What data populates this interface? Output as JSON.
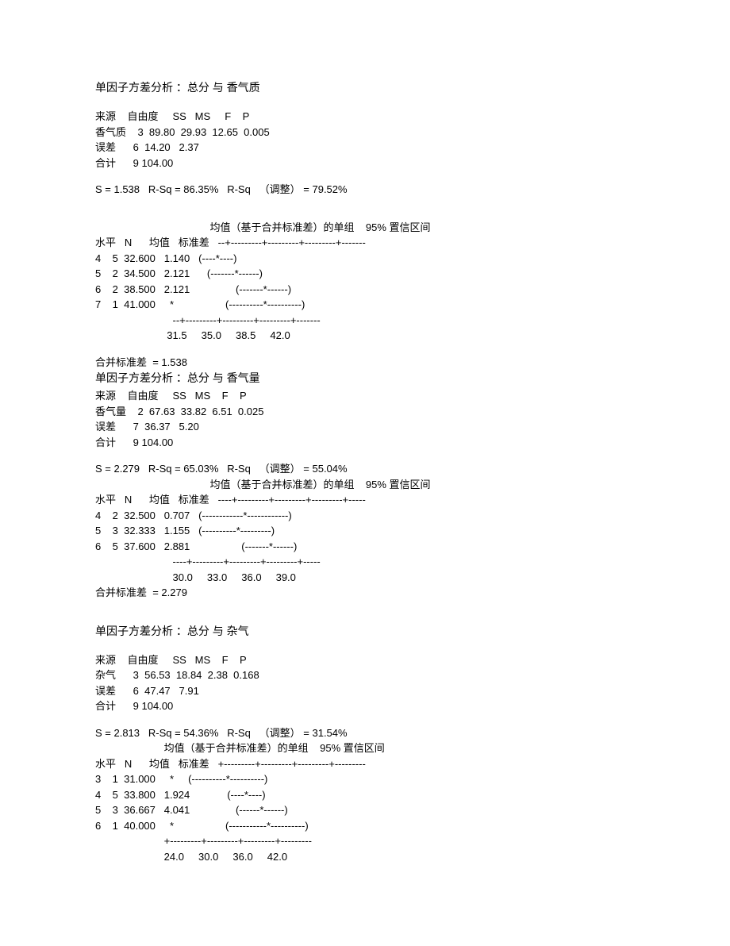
{
  "sections": [
    {
      "title": "单因子方差分析 ：总分  与 香气质",
      "anova_header": "来源    自由度     SS   MS     F    P",
      "anova_rows": [
        "香气质    3  89.80  29.93  12.65  0.005",
        "误差      6  14.20   2.37",
        "合计      9 104.00"
      ],
      "summary": "S = 1.538   R-Sq = 86.35%   R-Sq   （调整） = 79.52%",
      "ci_title": "                                        均值（基于合并标准差）的单组    95% 置信区间",
      "level_header": "水平   N      均值   标准差   --+---------+---------+---------+-------",
      "level_rows": [
        "4    5  32.600   1.140   (----*----)",
        "5    2  34.500   2.121      (-------*------)",
        "6    2  38.500   2.121                (-------*------)",
        "7    1  41.000     *                  (----------*----------)"
      ],
      "axis_ruler": "                           --+---------+---------+---------+-------",
      "axis_labels": "                         31.5     35.0     38.5     42.0",
      "pooled_sd": "合并标准差  = 1.538"
    },
    {
      "title": "单因子方差分析 ：总分  与 香气量",
      "anova_header": "来源    自由度     SS   MS    F    P",
      "anova_rows": [
        "香气量    2  67.63  33.82  6.51  0.025",
        "误差      7  36.37   5.20",
        "合计      9 104.00"
      ],
      "summary": "S = 2.279   R-Sq = 65.03%   R-Sq   （调整） = 55.04%",
      "ci_title": "                                        均值（基于合并标准差）的单组    95% 置信区间",
      "level_header": "水平   N      均值   标准差   ----+---------+---------+---------+-----",
      "level_rows": [
        "4    2  32.500   0.707   (------------*------------)",
        "5    3  32.333   1.155   (----------*---------)",
        "6    5  37.600   2.881                  (-------*------)"
      ],
      "axis_ruler": "                           ----+---------+---------+---------+-----",
      "axis_labels": "                           30.0     33.0     36.0     39.0",
      "pooled_sd": "合并标准差  = 2.279"
    },
    {
      "title": "单因子方差分析 ：总分  与 杂气",
      "anova_header": "来源    自由度     SS   MS    F    P",
      "anova_rows": [
        "杂气      3  56.53  18.84  2.38  0.168",
        "误差      6  47.47   7.91",
        "合计      9 104.00"
      ],
      "summary": "S = 2.813   R-Sq = 54.36%   R-Sq   （调整） = 31.54%",
      "ci_title": "                        均值（基于合并标准差）的单组    95% 置信区间",
      "level_header": "水平   N      均值   标准差   +---------+---------+---------+---------",
      "level_rows": [
        "3    1  31.000     *     (----------*----------)",
        "4    5  33.800   1.924             (----*----)",
        "5    3  36.667   4.041                (------*------)",
        "6    1  40.000     *                  (-----------*----------)"
      ],
      "axis_ruler": "                        +---------+---------+---------+---------",
      "axis_labels": "                        24.0     30.0     36.0     42.0",
      "pooled_sd": ""
    }
  ]
}
